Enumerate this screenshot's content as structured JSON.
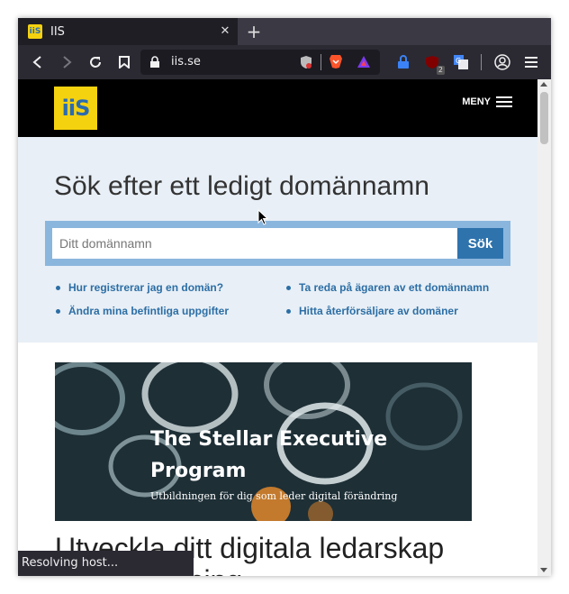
{
  "browser": {
    "tab_title": "IIS",
    "tab_favicon_text": "iiS",
    "url": "iis.se",
    "extension_badge": "2",
    "status_text": "Resolving host..."
  },
  "site": {
    "logo_text": "iiS",
    "menu_label": "MENY",
    "brand_color": "#f5d20f",
    "link_color": "#2c6ea5"
  },
  "hero": {
    "title": "Sök efter ett ledigt domännamn",
    "search_placeholder": "Ditt domännamn",
    "search_button": "Sök",
    "links": [
      "Hur registrerar jag en domän?",
      "Ta reda på ägaren av ett domännamn",
      "Ändra mina befintliga uppgifter",
      "Hitta återförsäljare av domäner"
    ]
  },
  "banner": {
    "title_line1": "The Stellar Executive",
    "title_line2": "Program",
    "subtitle": "Utbildningen för dig som leder digital förändring"
  },
  "article": {
    "title_line1": "Utveckla ditt digitala ledarskap",
    "title_line2": "med utbildning"
  }
}
